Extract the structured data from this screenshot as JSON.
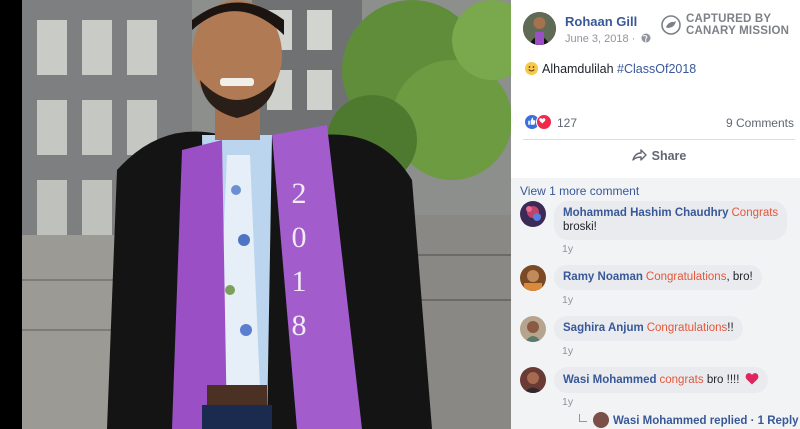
{
  "post": {
    "author": "Rohaan Gill",
    "date": "June 3, 2018",
    "date_separator": " · ",
    "text_main": "Alhamdulilah ",
    "hashtag": "#ClassOf2018",
    "reaction_count": "127",
    "comments_count": "9 Comments",
    "share_label": "Share"
  },
  "watermark": {
    "line1": "CAPTURED BY",
    "line2": "CANARY MISSION"
  },
  "photo": {
    "stole_text": [
      "2",
      "0",
      "1",
      "8"
    ]
  },
  "comments": {
    "view_more": "View 1 more comment",
    "items": [
      {
        "name": "Mohammad Hashim Chaudhry",
        "tag": "Congrats",
        "body": "broski!",
        "time": "1y"
      },
      {
        "name": "Ramy Noaman",
        "tag": "Congratulations",
        "body": ", bro!",
        "time": "1y"
      },
      {
        "name": "Saghira Anjum",
        "tag": "Congratulations",
        "body": "!!",
        "time": "1y"
      },
      {
        "name": "Wasi Mohammed",
        "tag": "congrats",
        "body": " bro !!!! ",
        "time": "1y"
      }
    ],
    "reply": {
      "text": "Wasi Mohammed replied · 1 Reply"
    }
  },
  "colors": {
    "link": "#385898",
    "tag": "#e4573c",
    "stole": "#9b4fc4",
    "gown": "#141414"
  }
}
